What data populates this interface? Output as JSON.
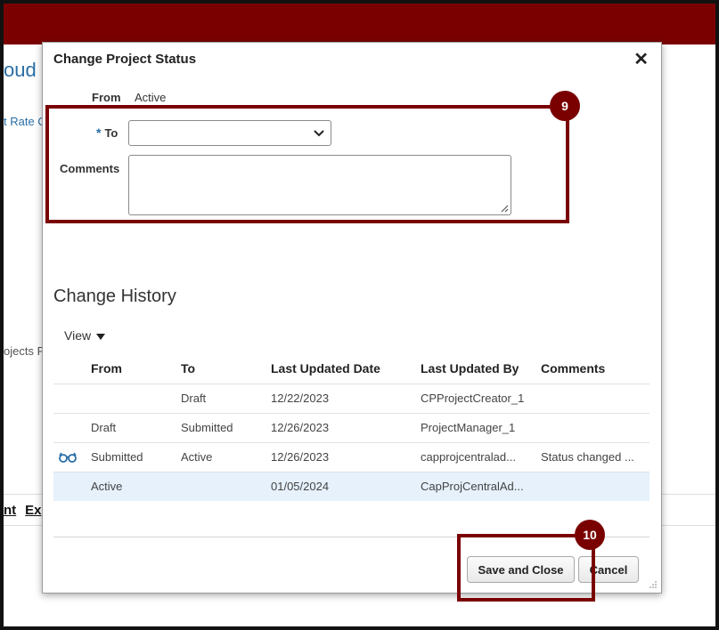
{
  "background": {
    "title_fragment": "oud F",
    "link_fragment": "t Rate C",
    "label_fragment": "ojects F",
    "tabs": [
      "nt",
      "Ex"
    ]
  },
  "dialog": {
    "title": "Change Project Status",
    "close_icon": "close-icon",
    "from_label": "From",
    "from_value": "Active",
    "required_marker": "*",
    "to_label": "To",
    "to_value": "",
    "comments_label": "Comments",
    "comments_value": "",
    "history_title": "Change History",
    "view_menu_label": "View",
    "history_columns": [
      "From",
      "To",
      "Last Updated Date",
      "Last Updated By",
      "Comments"
    ],
    "history_rows": [
      {
        "icon": "",
        "from": "",
        "to": "Draft",
        "date": "12/22/2023",
        "by": "CPProjectCreator_1",
        "comments": ""
      },
      {
        "icon": "",
        "from": "Draft",
        "to": "Submitted",
        "date": "12/26/2023",
        "by": "ProjectManager_1",
        "comments": ""
      },
      {
        "icon": "view-details-icon",
        "from": "Submitted",
        "to": "Active",
        "date": "12/26/2023",
        "by": "capprojcentralad...",
        "comments": "Status changed ..."
      },
      {
        "icon": "",
        "from": "Active",
        "to": "",
        "date": "01/05/2024",
        "by": "CapProjCentralAd...",
        "comments": "",
        "selected": true
      }
    ],
    "save_button_label": "Save and Close",
    "cancel_button_label": "Cancel"
  },
  "annotations": {
    "step_9": "9",
    "step_10": "10",
    "color": "#7a0000"
  }
}
